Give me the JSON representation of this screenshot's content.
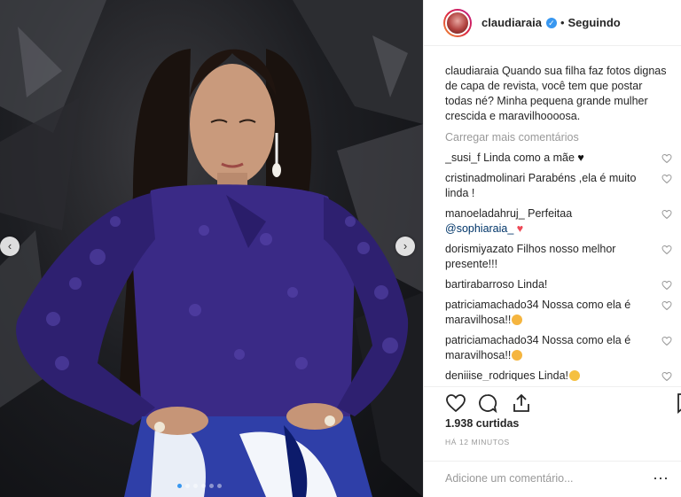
{
  "post": {
    "username": "claudiaraia",
    "separator": "•",
    "follow_status": "Seguindo",
    "verified_icon": "check-icon",
    "caption_user": "claudiaraia",
    "caption_text": "Quando sua filha faz fotos dignas de capa de revista, você tem que postar todas né? Minha pequena grande mulher crescida e maravilhoooosa.",
    "load_more": "Carregar mais comentários",
    "likes": "1.938 curtidas",
    "time": "HÁ 12 MINUTOS",
    "add_comment_placeholder": "Adicione um comentário...",
    "more_options": "···"
  },
  "comments": [
    {
      "user": "_susi_f",
      "text": "Linda como a mãe",
      "emoji": "black-heart"
    },
    {
      "user": "cristinadmolinari",
      "text": "Parabéns ,ela é muito linda !",
      "emoji": ""
    },
    {
      "user": "manoeladahruj_",
      "text": "Perfeitaa",
      "mention": "@sophiaraia_",
      "emoji": "red-heart"
    },
    {
      "user": "dorismiyazato",
      "text": "Filhos nosso melhor presente!!!",
      "emoji": ""
    },
    {
      "user": "bartirabarroso",
      "text": "Linda!",
      "emoji": ""
    },
    {
      "user": "patriciamachado34",
      "text": "Nossa como ela é maravilhosa!!",
      "emoji": "clap"
    },
    {
      "user": "patriciamachado34",
      "text": "Nossa como ela é maravilhosa!!",
      "emoji": "clap"
    },
    {
      "user": "deniiise_rodriques",
      "text": "Linda!",
      "emoji": "heart-eyes"
    }
  ],
  "colors": {
    "accent": "#3897f0",
    "red_heart": "#ed4956",
    "dress": "#3a2a86"
  },
  "carousel": {
    "total": 6,
    "active_index": 0
  }
}
